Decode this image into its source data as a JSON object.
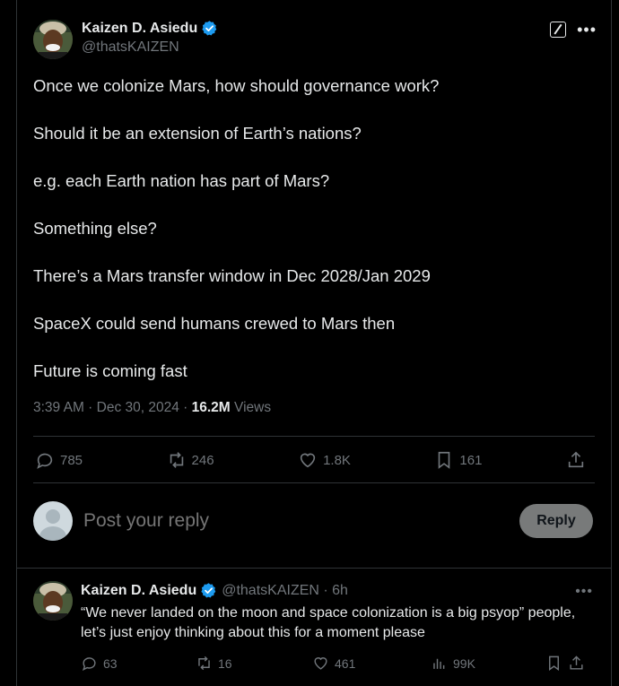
{
  "post": {
    "author": {
      "display_name": "Kaizen D. Asiedu",
      "handle": "@thatsKAIZEN",
      "verified": true
    },
    "paragraphs": [
      "Once we colonize Mars, how should governance work?",
      "Should it be an extension of Earth’s nations?",
      "e.g. each Earth nation has part of Mars?",
      "Something else?",
      "There’s a Mars transfer window in Dec 2028/Jan 2029",
      "SpaceX could send humans crewed to Mars then",
      "Future is coming fast"
    ],
    "timestamp": "3:39 AM · Dec 30, 2024 · ",
    "views_count": "16.2M",
    "views_label": " Views",
    "stats": {
      "replies": "785",
      "reposts": "246",
      "likes": "1.8K",
      "bookmarks": "161"
    }
  },
  "composer": {
    "placeholder": "Post your reply",
    "button_label": "Reply"
  },
  "reply": {
    "author": {
      "display_name": "Kaizen D. Asiedu",
      "handle": "@thatsKAIZEN · 6h"
    },
    "text": "“We never landed on the moon and space colonization is a big psyop” people, let’s just enjoy thinking about this for a moment please",
    "stats": {
      "replies": "63",
      "reposts": "16",
      "likes": "461",
      "views": "99K"
    }
  },
  "colors": {
    "background": "#000000",
    "text": "#e7e9ea",
    "muted": "#71767b",
    "verified": "#1d9bf0",
    "divider": "#2f3336"
  }
}
